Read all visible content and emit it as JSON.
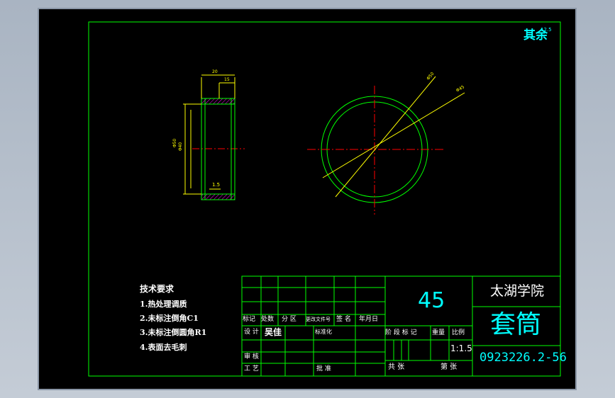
{
  "surface_finish": {
    "label": "其余",
    "value": "12.5"
  },
  "part_dims": {
    "overall_width": "20",
    "step_width": "15",
    "outer_diameter": "Φ50",
    "inner_diameter": "Φ40",
    "chamfer": "1.5"
  },
  "circle_dims": {
    "outer": "Φ50",
    "inner": "Φ45"
  },
  "tech_notes": {
    "title": "技术要求",
    "items": [
      "1.热处理调质",
      "2.未标注倒角C1",
      "3.未标注倒圆角R1",
      "4.表面去毛刺"
    ]
  },
  "title_block": {
    "headers": [
      "标记",
      "处数",
      "分 区",
      "更改文件号",
      "签 名",
      "年月日"
    ],
    "design_label": "设 计",
    "designer": "吴佳",
    "standardize_label": "标准化",
    "review_label": "审 核",
    "process_label": "工 艺",
    "approve_label": "批 准",
    "material": "45",
    "stage_label": "阶 段 标 记",
    "weight_label": "重量",
    "scale_label": "比例",
    "scale": "1:1.5",
    "sheets_label": "共  张",
    "sheet_no_label": "第  张",
    "school": "太湖学院",
    "part_name": "套筒",
    "drawing_no": "0923226.2-56"
  },
  "colors": {
    "background": "#000000",
    "frame": "#00ff00",
    "dimension": "#ffff00",
    "centerline": "#ff0000",
    "hatch": "#ff00ff",
    "text": "#ffffff",
    "annotation": "#00ffff"
  }
}
